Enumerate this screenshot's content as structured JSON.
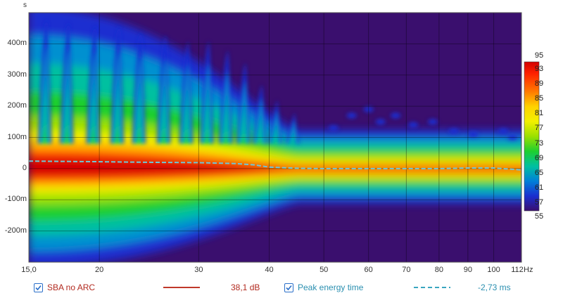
{
  "chart_data": {
    "type": "heatmap",
    "y_unit_label": "s",
    "x_unit_label": "Hz",
    "x_scale": "log",
    "xlim": [
      15,
      112
    ],
    "ylim": [
      -0.3,
      0.5
    ],
    "x_ticks": [
      {
        "value": 15,
        "label": "15,0"
      },
      {
        "value": 20,
        "label": "20"
      },
      {
        "value": 30,
        "label": "30"
      },
      {
        "value": 40,
        "label": "40"
      },
      {
        "value": 50,
        "label": "50"
      },
      {
        "value": 60,
        "label": "60"
      },
      {
        "value": 70,
        "label": "70"
      },
      {
        "value": 80,
        "label": "80"
      },
      {
        "value": 90,
        "label": "90"
      },
      {
        "value": 100,
        "label": "100"
      },
      {
        "value": 112,
        "label": "112"
      }
    ],
    "y_ticks": [
      {
        "value": 0.4,
        "label": "400m"
      },
      {
        "value": 0.3,
        "label": "300m"
      },
      {
        "value": 0.2,
        "label": "200m"
      },
      {
        "value": 0.1,
        "label": "100m"
      },
      {
        "value": 0.0,
        "label": "0"
      },
      {
        "value": -0.1,
        "label": "-100m"
      },
      {
        "value": -0.2,
        "label": "-200m"
      }
    ],
    "colorbar": {
      "min": 55,
      "max": 95,
      "labels": [
        "95",
        "93",
        "89",
        "85",
        "81",
        "77",
        "73",
        "69",
        "65",
        "61",
        "57",
        "55"
      ],
      "label_values": [
        95,
        93,
        89,
        85,
        81,
        77,
        73,
        69,
        65,
        61,
        57,
        55
      ]
    },
    "background_color": "#3a0f6e",
    "peak_energy_time": {
      "color": "#6ec6d8",
      "x": [
        15,
        20,
        25,
        30,
        35,
        37.5,
        40,
        45,
        50,
        60,
        70,
        80,
        90,
        100,
        112
      ],
      "y": [
        0.024,
        0.022,
        0.02,
        0.019,
        0.016,
        0.012,
        0.005,
        0.001,
        0.0,
        0.0,
        0.0,
        0.0,
        0.002,
        0.002,
        -0.004
      ]
    },
    "grid": true
  },
  "legend": {
    "series1": {
      "name": "SBA no ARC",
      "value": "38,1 dB",
      "color": "#c0392b",
      "checked": true
    },
    "series2": {
      "name": "Peak energy time",
      "value": "-2,73 ms",
      "color": "#3aa6c0",
      "checked": true
    }
  }
}
